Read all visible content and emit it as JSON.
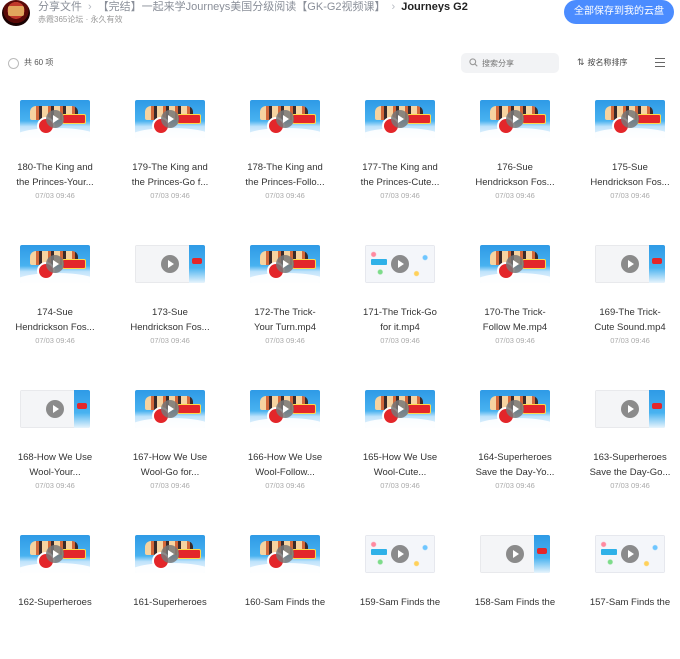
{
  "header": {
    "breadcrumb": [
      {
        "label": "分享文件"
      },
      {
        "label": "【完结】一起来学Journeys美国分级阅读【GK-G2视频课】"
      },
      {
        "label": "Journeys G2"
      }
    ],
    "subtitle": "赤霞365论坛 · 永久有效",
    "save_button": "全部保存到我的云盘"
  },
  "toolbar": {
    "count_label": "共 60 项",
    "search_placeholder": "搜索分享",
    "sort_label": "按名称排序",
    "icons": {
      "search": "search-icon",
      "sort": "sort-icon",
      "menu": "list-view-icon"
    }
  },
  "colors": {
    "accent": "#4b8cff"
  },
  "files": [
    {
      "line1": "180-The King and",
      "line2": "the Princes-Your...",
      "date": "07/03 09:46",
      "thumb": "cartoon"
    },
    {
      "line1": "179-The King and",
      "line2": "the Princes-Go f...",
      "date": "07/03 09:46",
      "thumb": "cartoon"
    },
    {
      "line1": "178-The King and",
      "line2": "the Princes-Follo...",
      "date": "07/03 09:46",
      "thumb": "cartoon"
    },
    {
      "line1": "177-The King and",
      "line2": "the Princes-Cute...",
      "date": "07/03 09:46",
      "thumb": "cartoon"
    },
    {
      "line1": "176-Sue",
      "line2": "Hendrickson Fos...",
      "date": "07/03 09:46",
      "thumb": "cartoon"
    },
    {
      "line1": "175-Sue",
      "line2": "Hendrickson Fos...",
      "date": "07/03 09:46",
      "thumb": "cartoon"
    },
    {
      "line1": "174-Sue",
      "line2": "Hendrickson Fos...",
      "date": "07/03 09:46",
      "thumb": "cartoon"
    },
    {
      "line1": "173-Sue",
      "line2": "Hendrickson Fos...",
      "date": "07/03 09:46",
      "thumb": "blank"
    },
    {
      "line1": "172-The Trick-",
      "line2": "Your Turn.mp4",
      "date": "07/03 09:46",
      "thumb": "cartoon"
    },
    {
      "line1": "171-The Trick-Go",
      "line2": "for it.mp4",
      "date": "07/03 09:46",
      "thumb": "light"
    },
    {
      "line1": "170-The Trick-",
      "line2": "Follow Me.mp4",
      "date": "07/03 09:46",
      "thumb": "cartoon"
    },
    {
      "line1": "169-The Trick-",
      "line2": "Cute Sound.mp4",
      "date": "07/03 09:46",
      "thumb": "blank"
    },
    {
      "line1": "168-How We Use",
      "line2": "Wool-Your...",
      "date": "07/03 09:46",
      "thumb": "blank"
    },
    {
      "line1": "167-How We Use",
      "line2": "Wool-Go for...",
      "date": "07/03 09:46",
      "thumb": "cartoon"
    },
    {
      "line1": "166-How We Use",
      "line2": "Wool-Follow...",
      "date": "07/03 09:46",
      "thumb": "cartoon"
    },
    {
      "line1": "165-How We Use",
      "line2": "Wool-Cute...",
      "date": "07/03 09:46",
      "thumb": "cartoon"
    },
    {
      "line1": "164-Superheroes",
      "line2": "Save the Day-Yo...",
      "date": "07/03 09:46",
      "thumb": "cartoon"
    },
    {
      "line1": "163-Superheroes",
      "line2": "Save the Day-Go...",
      "date": "07/03 09:46",
      "thumb": "blank"
    },
    {
      "line1": "162-Superheroes",
      "line2": "",
      "date": "",
      "thumb": "cartoon"
    },
    {
      "line1": "161-Superheroes",
      "line2": "",
      "date": "",
      "thumb": "cartoon"
    },
    {
      "line1": "160-Sam Finds the",
      "line2": "",
      "date": "",
      "thumb": "cartoon"
    },
    {
      "line1": "159-Sam Finds the",
      "line2": "",
      "date": "",
      "thumb": "light"
    },
    {
      "line1": "158-Sam Finds the",
      "line2": "",
      "date": "",
      "thumb": "blank"
    },
    {
      "line1": "157-Sam Finds the",
      "line2": "",
      "date": "",
      "thumb": "light"
    }
  ]
}
